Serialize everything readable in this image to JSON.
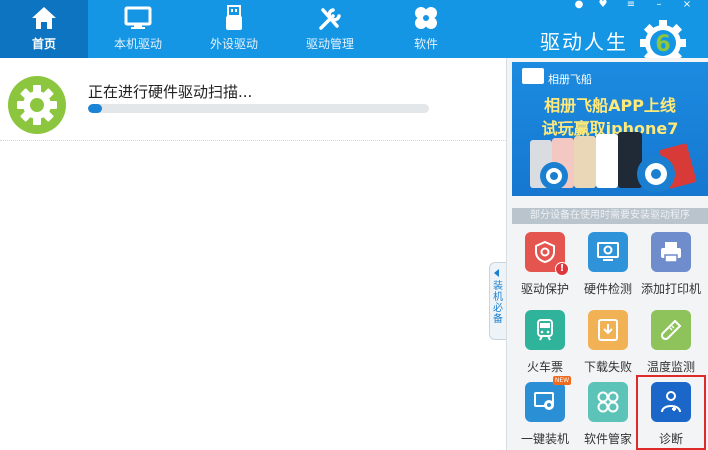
{
  "header": {
    "nav": [
      {
        "label": "首页",
        "icon": "home-icon"
      },
      {
        "label": "本机驱动",
        "icon": "monitor-icon"
      },
      {
        "label": "外设驱动",
        "icon": "usb-icon"
      },
      {
        "label": "驱动管理",
        "icon": "wrench-icon"
      },
      {
        "label": "软件",
        "icon": "clover-icon"
      }
    ],
    "brand": "驱动人生",
    "logo_digit": "6"
  },
  "scan": {
    "status_text": "正在进行硬件驱动扫描...",
    "progress_fraction": 0.04
  },
  "side_tab": {
    "label": "装机必备"
  },
  "banner": {
    "brand": "相册飞船",
    "line1": "相册飞船APP上线",
    "line2": "试玩赢取iphone7"
  },
  "notice": "部分设备在使用时需要安装驱动程序",
  "tools": [
    {
      "label": "驱动保护",
      "icon": "shield-gear-icon",
      "color": "#e5554f"
    },
    {
      "label": "硬件检测",
      "icon": "monitor-check-icon",
      "color": "#2f93da"
    },
    {
      "label": "添加打印机",
      "icon": "printer-icon",
      "color": "#6f8ccd"
    },
    {
      "label": "火车票",
      "icon": "train-icon",
      "color": "#2fb39a"
    },
    {
      "label": "下载失败",
      "icon": "download-fail-icon",
      "color": "#f0b254"
    },
    {
      "label": "温度监测",
      "icon": "thermometer-icon",
      "color": "#8dc35a"
    },
    {
      "label": "一键装机",
      "icon": "install-icon",
      "color": "#2b8fd6"
    },
    {
      "label": "软件管家",
      "icon": "apps-icon",
      "color": "#5cc3b8"
    },
    {
      "label": "诊断",
      "icon": "doctor-icon",
      "color": "#1b66c9"
    }
  ],
  "badges": {
    "new": "NEW",
    "warn": "!"
  },
  "colors": {
    "header_bg": "#1596e5",
    "header_active": "#0d74c2",
    "progress": "#1b84d6",
    "accent_green": "#8cc63f"
  }
}
